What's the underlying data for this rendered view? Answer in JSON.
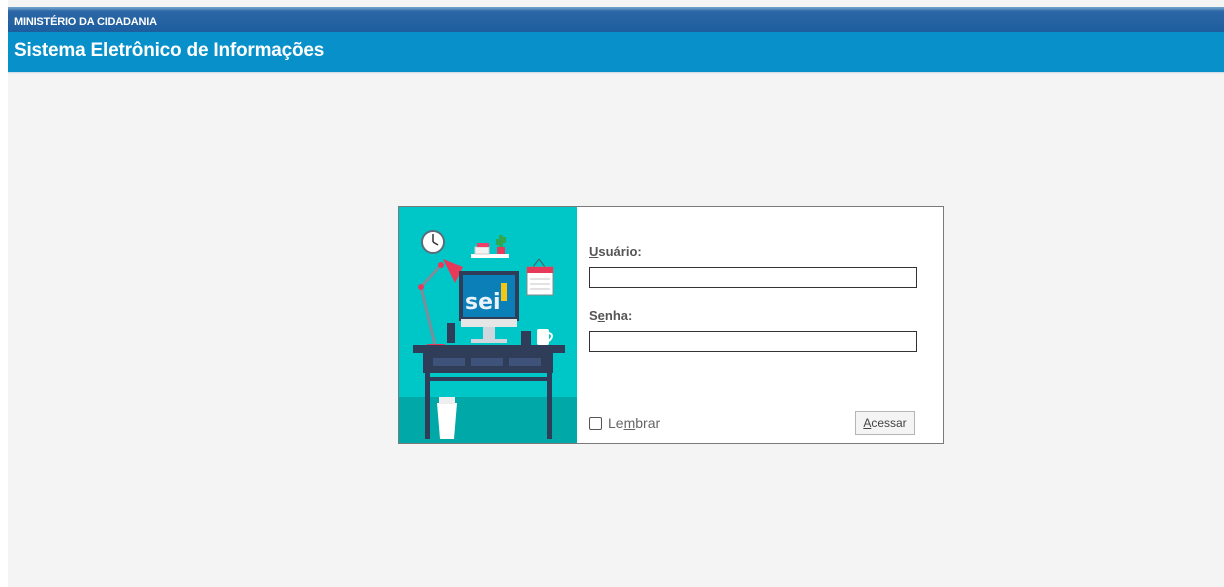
{
  "header": {
    "ministry": "MINISTÉRIO DA CIDADANIA",
    "system_title": "Sistema Eletrônico de Informações"
  },
  "login": {
    "illustration_text": "sei",
    "username": {
      "label_hotkey": "U",
      "label_rest": "suário:",
      "value": ""
    },
    "password": {
      "label_first": "S",
      "label_hotkey": "e",
      "label_rest": "nha:",
      "value": ""
    },
    "remember": {
      "label_first": "Le",
      "label_hotkey": "m",
      "label_rest": "brar",
      "checked": false
    },
    "submit": {
      "label_hotkey": "A",
      "label_rest": "cessar"
    }
  },
  "colors": {
    "topbar": "#1d5e9e",
    "titlebar": "#0790c9",
    "illustration_bg": "#00c7c7",
    "background": "#f4f4f4"
  }
}
